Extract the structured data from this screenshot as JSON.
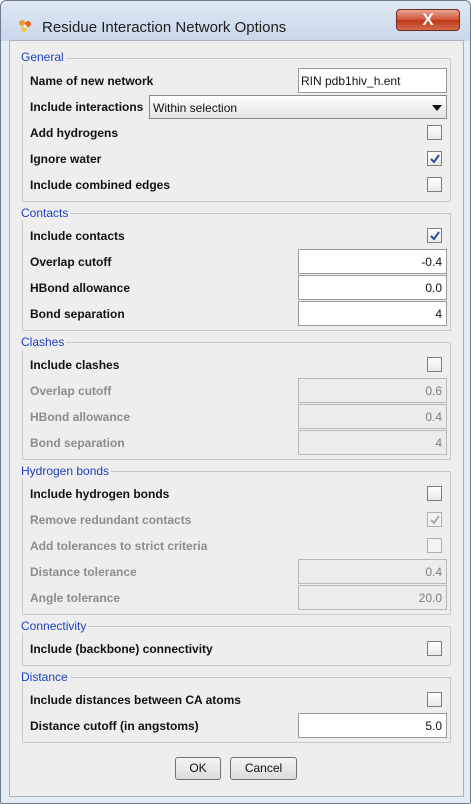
{
  "window": {
    "title": "Residue Interaction Network Options",
    "close_label": "X",
    "icon": "cytoscape-flower-icon"
  },
  "general": {
    "title": "General",
    "network_name_label": "Name of new network",
    "network_name_value": "RIN pdb1hiv_h.ent",
    "include_interactions_label": "Include interactions",
    "include_interactions_value": "Within selection",
    "add_hydrogens_label": "Add hydrogens",
    "add_hydrogens_checked": false,
    "ignore_water_label": "Ignore water",
    "ignore_water_checked": true,
    "combined_edges_label": "Include combined edges",
    "combined_edges_checked": false
  },
  "contacts": {
    "title": "Contacts",
    "include_label": "Include contacts",
    "include_checked": true,
    "overlap_label": "Overlap cutoff",
    "overlap_value": "-0.4",
    "hbond_label": "HBond allowance",
    "hbond_value": "0.0",
    "bond_sep_label": "Bond separation",
    "bond_sep_value": "4"
  },
  "clashes": {
    "title": "Clashes",
    "include_label": "Include clashes",
    "include_checked": false,
    "overlap_label": "Overlap cutoff",
    "overlap_value": "0.6",
    "hbond_label": "HBond allowance",
    "hbond_value": "0.4",
    "bond_sep_label": "Bond separation",
    "bond_sep_value": "4"
  },
  "hbonds": {
    "title": "Hydrogen bonds",
    "include_label": "Include hydrogen bonds",
    "include_checked": false,
    "remove_redundant_label": "Remove redundant contacts",
    "remove_redundant_checked": true,
    "add_tolerances_label": "Add tolerances to strict criteria",
    "add_tolerances_checked": false,
    "distance_tol_label": "Distance tolerance",
    "distance_tol_value": "0.4",
    "angle_tol_label": "Angle tolerance",
    "angle_tol_value": "20.0"
  },
  "connectivity": {
    "title": "Connectivity",
    "include_label": "Include (backbone) connectivity",
    "include_checked": false
  },
  "distance": {
    "title": "Distance",
    "include_label": "Include distances between CA atoms",
    "include_checked": false,
    "cutoff_label": "Distance cutoff (in angstoms)",
    "cutoff_value": "5.0"
  },
  "buttons": {
    "ok_label": "OK",
    "cancel_label": "Cancel"
  }
}
